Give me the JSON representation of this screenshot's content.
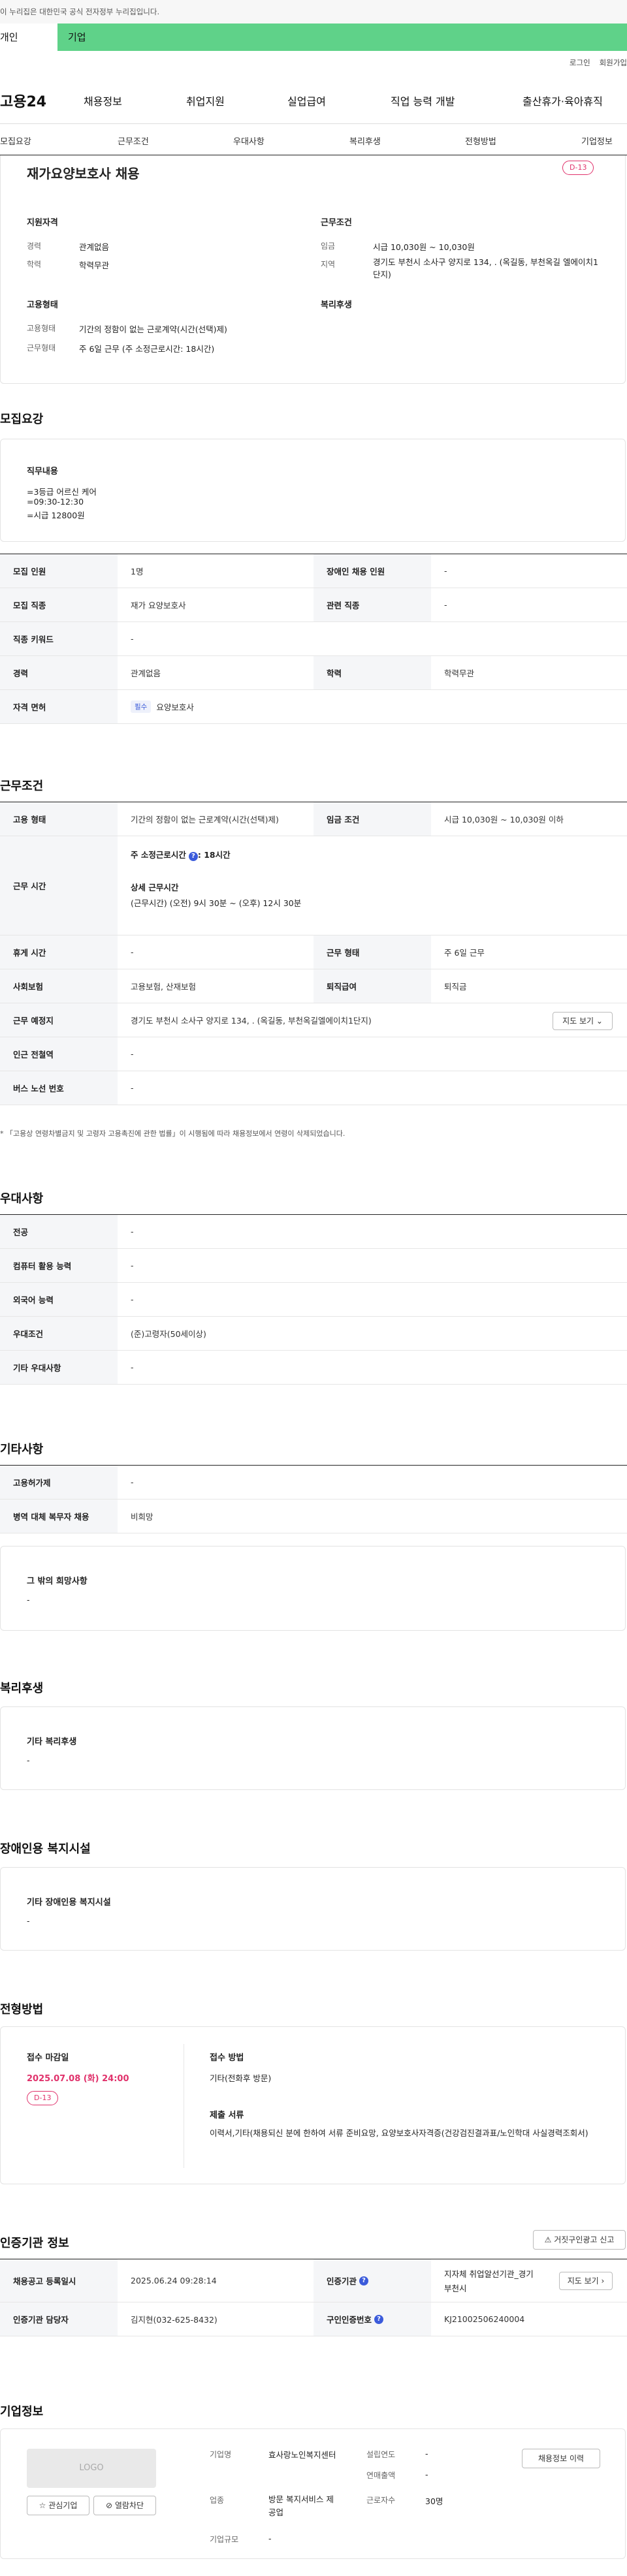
{
  "gov_banner": "이 누리집은 대한민국 공식 전자정부 누리집입니다.",
  "user_tabs": {
    "personal": "개인",
    "company": "기업"
  },
  "top_links": {
    "login": "로그인",
    "join": "회원가입"
  },
  "gnb": {
    "logo": "고용24",
    "items": [
      "채용정보",
      "취업지원",
      "실업급여",
      "직업 능력 개발",
      "출산휴가·육아휴직"
    ]
  },
  "anchor_nav": [
    "모집요강",
    "근무조건",
    "우대사항",
    "복리후생",
    "전형방법",
    "기업정보"
  ],
  "summary": {
    "title": "재가요양보호사 채용",
    "dday": "D-13",
    "qual_title": "지원자격",
    "career_label": "경력",
    "career": "관계없음",
    "edu_label": "학력",
    "edu": "학력무관",
    "cond_title": "근무조건",
    "wage_label": "임금",
    "wage": "시급 10,030원 ~ 10,030원",
    "region_label": "지역",
    "region": "경기도 부천시 소사구 양지로 134, . (옥길동, 부천옥길 엘에이치1단지)",
    "emp_title": "고용형태",
    "emp_type_label": "고용형태",
    "emp_type": "기간의 정함이 없는 근로계약(시간(선택)제)",
    "work_type_label": "근무형태",
    "work_type": "주 6일 근무 (주 소정근로시간: 18시간)",
    "welfare_title": "복리후생"
  },
  "recruit": {
    "title": "모집요강",
    "duty_title": "직무내용",
    "duty_lines": [
      "=3등급 어르신 케어",
      "=09:30-12:30",
      "=시급 12800원"
    ],
    "rows": [
      {
        "k1": "모집 인원",
        "v1": "1명",
        "k2": "장애인 채용 인원",
        "v2": "-"
      },
      {
        "k1": "모집 직종",
        "v1": "재가 요양보호사",
        "k2": "관련 직종",
        "v2": "-"
      },
      {
        "k1": "직종 키워드",
        "v1": "-"
      },
      {
        "k1": "경력",
        "v1": "관계없음",
        "k2": "학력",
        "v2": "학력무관"
      },
      {
        "k1": "자격 면허",
        "chip": "필수",
        "v1": "요양보호사"
      }
    ]
  },
  "work": {
    "title": "근무조건",
    "emp_type_k": "고용 형태",
    "emp_type_v": "기간의 정함이 없는 근로계약(시간(선택)제)",
    "wage_k": "임금 조건",
    "wage_v": "시급 10,030원 ~ 10,030원 이하",
    "hours_k": "근무 시간",
    "hours_week": "주 소정근로시간",
    "hours_week_v": ": 18시간",
    "hours_detail_title": "상세 근무시간",
    "hours_detail": "(근무시간) (오전) 9시 30분 ~ (오후) 12시 30분",
    "rest_k": "휴게 시간",
    "rest_v": "-",
    "shift_k": "근무 형태",
    "shift_v": "주 6일 근무",
    "ins_k": "사회보험",
    "ins_v": "고용보험, 산재보험",
    "sev_k": "퇴직급여",
    "sev_v": "퇴직금",
    "place_k": "근무 예정지",
    "place_v": "경기도 부천시 소사구 양지로 134, . (옥길동, 부천옥길엘에이치1단지)",
    "map_btn": "지도 보기",
    "subway_k": "인근 전철역",
    "subway_v": "-",
    "bus_k": "버스 노선 번호",
    "bus_v": "-",
    "notice": "「고용상 연령차별금지 및 고령자 고용촉진에 관한 법률」이 시행됨에 따라 채용정보에서 연령이 삭제되었습니다."
  },
  "pref": {
    "title": "우대사항",
    "rows": [
      {
        "k": "전공",
        "v": "-"
      },
      {
        "k": "컴퓨터 활용 능력",
        "v": "-"
      },
      {
        "k": "외국어 능력",
        "v": "-"
      },
      {
        "k": "우대조건",
        "v": "(준)고령자(50세이상)"
      },
      {
        "k": "기타 우대사항",
        "v": "-"
      }
    ]
  },
  "etc": {
    "title": "기타사항",
    "rows": [
      {
        "k": "고용허가제",
        "v": "-"
      },
      {
        "k": "병역 대체 복무자 채용",
        "v": "비희망"
      }
    ],
    "other_title": "그 밖의 희망사항",
    "other_v": "-"
  },
  "welfare": {
    "title": "복리후생",
    "box_title": "기타 복리후생",
    "box_v": "-"
  },
  "disabled": {
    "title": "장애인용 복지시설",
    "box_title": "기타 장애인용 복지시설",
    "box_v": "-"
  },
  "process": {
    "title": "전형방법",
    "deadline_title": "접수 마감일",
    "deadline": "2025.07.08 (화) 24:00",
    "dday": "D-13",
    "method_title": "접수 방법",
    "method": "기타(전화후 방문)",
    "docs_title": "제출 서류",
    "docs": "이력서,기타(채용되신 분에 한하여 서류 준비요망, 요양보호사자격증(건강검진결과표/노인학대 사실경력조회서)"
  },
  "cert": {
    "title": "인증기관 정보",
    "report_btn": "거짓구인광고 신고",
    "reg_k": "채용공고 등록일시",
    "reg_v": "2025.06.24 09:28:14",
    "org_k": "인증기관",
    "org_v": "지자체 취업알선기관_경기 부천시",
    "map_btn": "지도 보기",
    "staff_k": "인증기관 담당자",
    "staff_v": "김지현(032-625-8432)",
    "id_k": "구인인증번호",
    "id_v": "KJ21002506240004"
  },
  "company": {
    "title": "기업정보",
    "logo": "LOGO",
    "fav_btn": "관심기업",
    "block_btn": "열람차단",
    "name_k": "기업명",
    "name_v": "효사랑노인복지센터",
    "found_k": "설립연도",
    "found_v": "-",
    "sales_k": "연매출액",
    "sales_v": "-",
    "biz_k": "업종",
    "biz_v": "방문 복지서비스 제공업",
    "emp_k": "근로자수",
    "emp_v": "30명",
    "size_k": "기업규모",
    "size_v": "-",
    "history_btn": "채용정보 이력"
  }
}
